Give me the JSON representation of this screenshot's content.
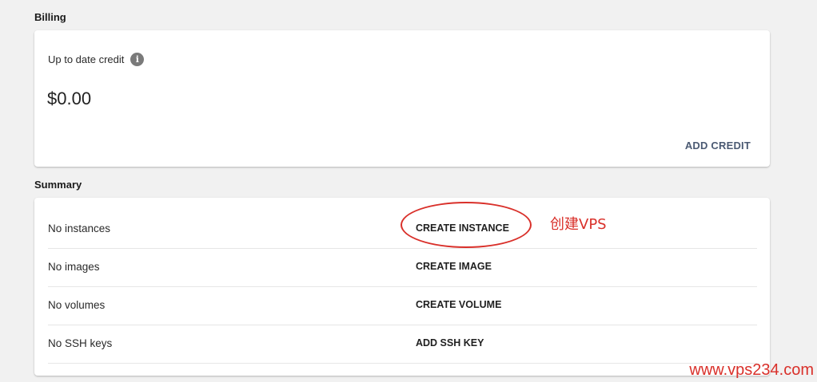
{
  "billing": {
    "heading": "Billing",
    "credit_label": "Up to date credit",
    "credit_amount": "$0.00",
    "add_credit_label": "ADD CREDIT"
  },
  "summary": {
    "heading": "Summary",
    "rows": [
      {
        "label": "No instances",
        "action": "CREATE INSTANCE"
      },
      {
        "label": "No images",
        "action": "CREATE IMAGE"
      },
      {
        "label": "No volumes",
        "action": "CREATE VOLUME"
      },
      {
        "label": "No SSH keys",
        "action": "ADD SSH KEY"
      }
    ]
  },
  "annotation": {
    "text": "创建VPS",
    "color": "#d9302a"
  },
  "watermark": "www.vps234.com"
}
